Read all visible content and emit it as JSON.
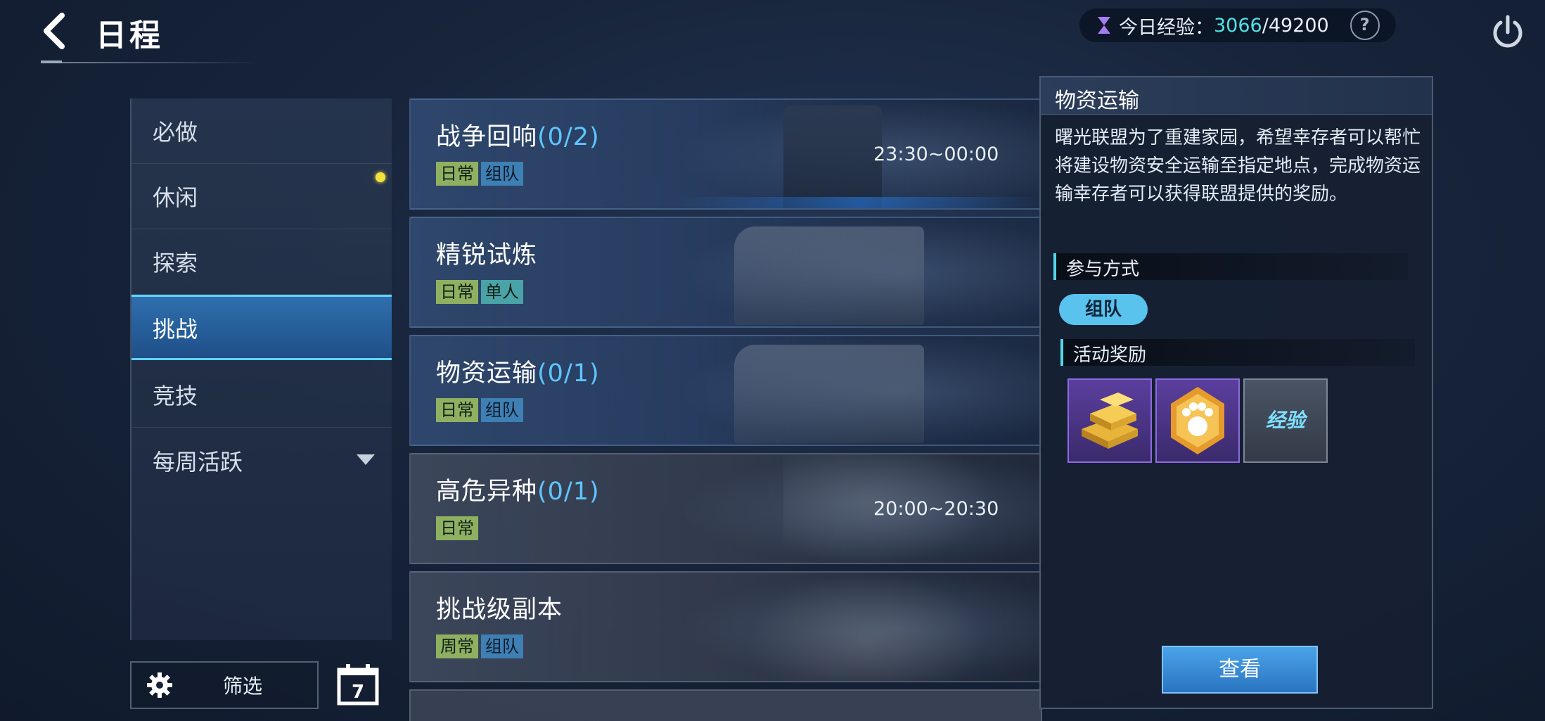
{
  "header": {
    "title": "日程",
    "exp_label": "今日经验：",
    "exp_current": "3066",
    "exp_separator": "/",
    "exp_max": "49200",
    "help_label": "?"
  },
  "sidebar": {
    "items": [
      {
        "label": "必做"
      },
      {
        "label": "休闲"
      },
      {
        "label": "探索"
      },
      {
        "label": "挑战"
      },
      {
        "label": "竞技"
      },
      {
        "label": "每周活跃"
      }
    ],
    "active_index": 3,
    "filter_label": "筛选",
    "calendar_day": "7"
  },
  "activities": [
    {
      "name": "战争回响",
      "progress": "(0/2)",
      "time": "23:30~00:00",
      "tags": [
        "日常",
        "组队"
      ]
    },
    {
      "name": "精锐试炼",
      "progress": "",
      "time": "",
      "tags": [
        "日常",
        "单人"
      ]
    },
    {
      "name": "物资运输",
      "progress": "(0/1)",
      "time": "",
      "tags": [
        "日常",
        "组队"
      ]
    },
    {
      "name": "高危异种",
      "progress": "(0/1)",
      "time": "20:00~20:30",
      "tags": [
        "日常"
      ]
    },
    {
      "name": "挑战级副本",
      "progress": "",
      "time": "",
      "tags": [
        "周常",
        "组队"
      ]
    }
  ],
  "detail": {
    "title": "物资运输",
    "description": "曙光联盟为了重建家园，希望幸存者可以帮忙将建设物资安全运输至指定地点，完成物资运输幸存者可以获得联盟提供的奖励。",
    "mode_heading": "参与方式",
    "mode_value": "组队",
    "reward_heading": "活动奖励",
    "rewards": [
      {
        "icon": "gold-bars-icon",
        "rarity": "purple"
      },
      {
        "icon": "paw-badge-icon",
        "rarity": "purple"
      },
      {
        "icon": "exp-icon",
        "rarity": "gray",
        "text": "经验"
      }
    ],
    "view_button": "查看"
  },
  "colors": {
    "accent_cyan": "#4fe3e6",
    "progress_blue": "#5ec6ff",
    "tag_green": "#8fb061",
    "tag_teal": "#49a3a7",
    "tag_blue": "#3e7fb4",
    "active_tab": "#2f6fae"
  }
}
